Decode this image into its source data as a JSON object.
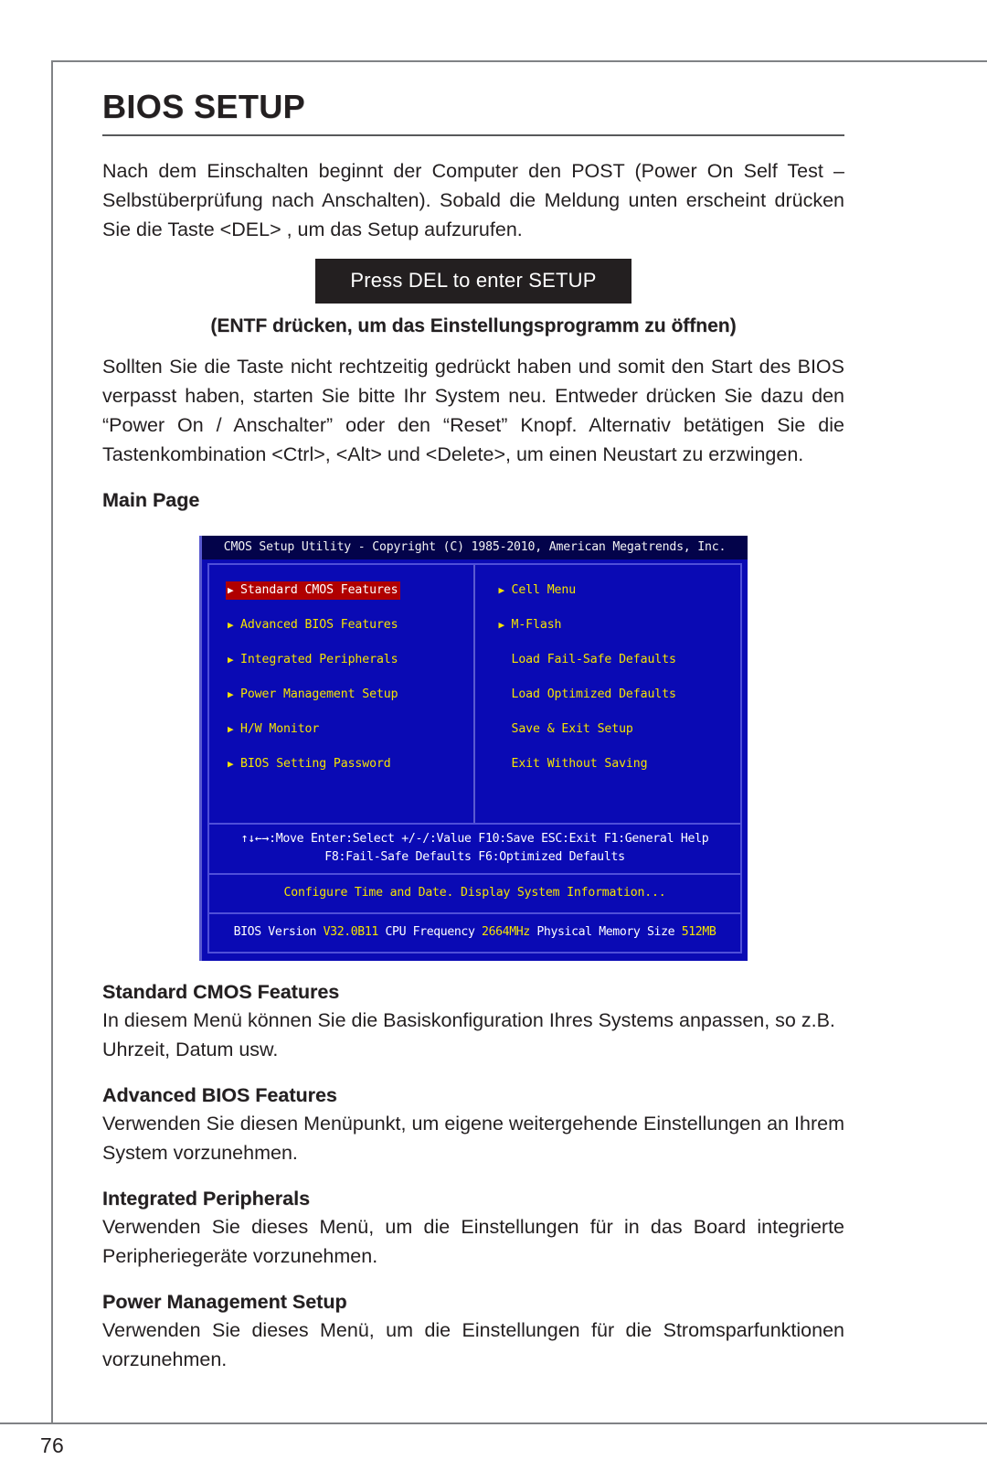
{
  "page": {
    "title": "BIOS SETUP",
    "number": "76"
  },
  "intro": {
    "paragraph": "Nach dem Einschalten beginnt der Computer den POST (Power On Self Test – Selbstüberprüfung nach Anschalten). Sobald die Meldung unten erscheint drücken Sie die Taste <DEL> , um das Setup aufzurufen."
  },
  "banner": {
    "text": "Press DEL to enter SETUP",
    "caption": "(ENTF drücken, um das Einstellungsprogramm zu öffnen)"
  },
  "paragraph2": "Sollten Sie die Taste nicht rechtzeitig gedrückt haben und somit den Start des BIOS verpasst haben, starten Sie bitte Ihr System neu. Entweder drücken Sie dazu den “Power On / Anschalter” oder den “Reset” Knopf. Alternativ betätigen Sie die Tastenkombination <Ctrl>, <Alt> und <Delete>, um einen Neustart zu erzwingen.",
  "main_page_heading": "Main Page",
  "bios": {
    "titlebar": "CMOS Setup Utility - Copyright (C) 1985-2010, American Megatrends, Inc.",
    "left_items": [
      {
        "label": "Standard CMOS Features",
        "arrow": "▶",
        "selected": true
      },
      {
        "label": "Advanced BIOS Features",
        "arrow": "▶",
        "selected": false
      },
      {
        "label": "Integrated Peripherals",
        "arrow": "▶",
        "selected": false
      },
      {
        "label": "Power Management Setup",
        "arrow": "▶",
        "selected": false
      },
      {
        "label": "H/W Monitor",
        "arrow": "▶",
        "selected": false
      },
      {
        "label": "BIOS Setting Password",
        "arrow": "▶",
        "selected": false
      }
    ],
    "right_items": [
      {
        "label": "Cell Menu",
        "arrow": "▶",
        "selected": false
      },
      {
        "label": "M-Flash",
        "arrow": "▶",
        "selected": false
      },
      {
        "label": "Load Fail-Safe Defaults",
        "arrow": "",
        "selected": false
      },
      {
        "label": "Load Optimized Defaults",
        "arrow": "",
        "selected": false
      },
      {
        "label": "Save & Exit Setup",
        "arrow": "",
        "selected": false
      },
      {
        "label": "Exit Without Saving",
        "arrow": "",
        "selected": false
      }
    ],
    "help_line1": "↑↓←→:Move   Enter:Select   +/-/:Value   F10:Save   ESC:Exit   F1:General Help",
    "help_line2": "F8:Fail-Safe Defaults    F6:Optimized Defaults",
    "hint_line": "Configure Time and Date.  Display System Information...",
    "status": {
      "bios_version_label": "BIOS Version",
      "bios_version_value": "V32.0B11",
      "cpu_freq_label": "CPU Frequency",
      "cpu_freq_value": "2664MHz",
      "memory_label": "Physical Memory Size",
      "memory_value": "512MB"
    },
    "colors": {
      "background": "#0a0ab4",
      "titlebar": "#03034a",
      "item_text": "#f5e300",
      "selected_bg": "#b00000",
      "selected_text": "#ffffff",
      "border": "#4f4fd8"
    }
  },
  "sections": [
    {
      "heading": "Standard CMOS Features",
      "body": "In diesem Menü können Sie die Basiskonfiguration Ihres Systems anpassen, so z.B. Uhrzeit, Datum usw."
    },
    {
      "heading": "Advanced BIOS Features",
      "body": "Verwenden Sie diesen Menüpunkt, um eigene weitergehende Einstellungen an Ihrem System vorzunehmen."
    },
    {
      "heading": "Integrated Peripherals",
      "body": "Verwenden Sie dieses Menü, um die Einstellungen für in das Board integrierte Peripheriegeräte vorzunehmen."
    },
    {
      "heading": "Power Management Setup",
      "body": "Verwenden Sie dieses Menü, um die Einstellungen für die Stromsparfunktionen vorzunehmen."
    }
  ]
}
